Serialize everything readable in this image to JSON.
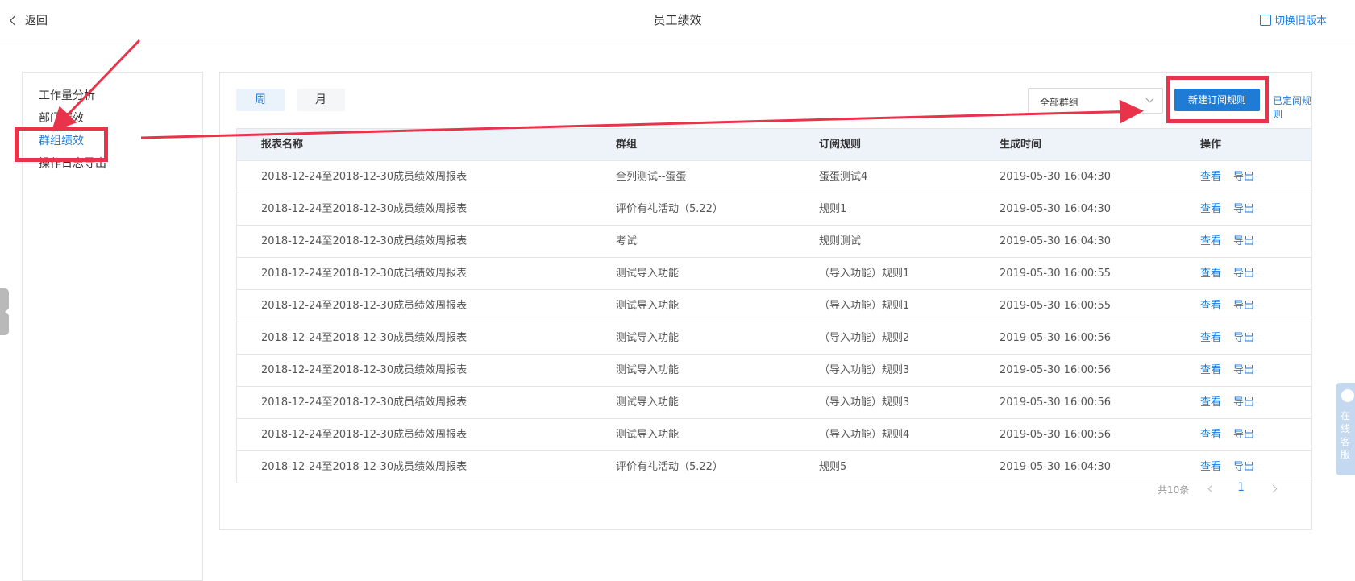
{
  "header": {
    "back_label": "返回",
    "title": "员工绩效",
    "switch_label": "切换旧版本"
  },
  "sidebar": {
    "items": [
      {
        "label": "工作量分析"
      },
      {
        "label": "部门绩效"
      },
      {
        "label": "群组绩效",
        "active": true
      },
      {
        "label": "操作日志导出"
      }
    ]
  },
  "toolbar": {
    "tab_week": "周",
    "tab_month": "月",
    "group_select": "全部群组",
    "new_rule_button": "新建订阅规则",
    "subscribed_rules_link": "已定阅规则"
  },
  "table": {
    "columns": [
      "报表名称",
      "群组",
      "订阅规则",
      "生成时间",
      "操作"
    ],
    "action_view": "查看",
    "action_export": "导出",
    "rows": [
      {
        "name": "2018-12-24至2018-12-30成员绩效周报表",
        "group": "全列测试--蛋蛋",
        "rule": "蛋蛋测试4",
        "time": "2019-05-30 16:04:30"
      },
      {
        "name": "2018-12-24至2018-12-30成员绩效周报表",
        "group": "评价有礼活动（5.22）",
        "rule": "规则1",
        "time": "2019-05-30 16:04:30"
      },
      {
        "name": "2018-12-24至2018-12-30成员绩效周报表",
        "group": "考试",
        "rule": "规则测试",
        "time": "2019-05-30 16:04:30"
      },
      {
        "name": "2018-12-24至2018-12-30成员绩效周报表",
        "group": "测试导入功能",
        "rule": "（导入功能）规则1",
        "time": "2019-05-30 16:00:55"
      },
      {
        "name": "2018-12-24至2018-12-30成员绩效周报表",
        "group": "测试导入功能",
        "rule": "（导入功能）规则1",
        "time": "2019-05-30 16:00:55"
      },
      {
        "name": "2018-12-24至2018-12-30成员绩效周报表",
        "group": "测试导入功能",
        "rule": "（导入功能）规则2",
        "time": "2019-05-30 16:00:56"
      },
      {
        "name": "2018-12-24至2018-12-30成员绩效周报表",
        "group": "测试导入功能",
        "rule": "（导入功能）规则3",
        "time": "2019-05-30 16:00:56"
      },
      {
        "name": "2018-12-24至2018-12-30成员绩效周报表",
        "group": "测试导入功能",
        "rule": "（导入功能）规则3",
        "time": "2019-05-30 16:00:56"
      },
      {
        "name": "2018-12-24至2018-12-30成员绩效周报表",
        "group": "测试导入功能",
        "rule": "（导入功能）规则4",
        "time": "2019-05-30 16:00:56"
      },
      {
        "name": "2018-12-24至2018-12-30成员绩效周报表",
        "group": "评价有礼活动（5.22）",
        "rule": "规则5",
        "time": "2019-05-30 16:04:30"
      }
    ]
  },
  "pagination": {
    "total": "共10条",
    "current_page": "1"
  },
  "service": {
    "label": "在线客服"
  },
  "colors": {
    "accent": "#1e7bd6",
    "annotation": "#e8334a"
  }
}
